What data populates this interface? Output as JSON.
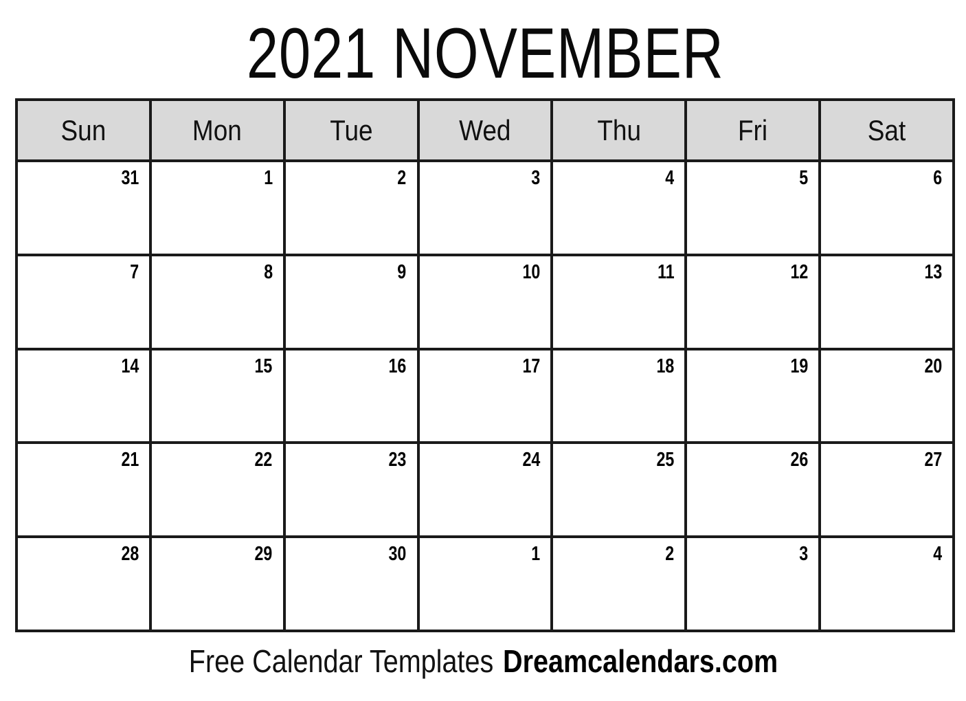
{
  "document": {
    "title": "2021 NOVEMBER",
    "year": "2021",
    "month": "NOVEMBER"
  },
  "colors": {
    "page_background": "#ffffff",
    "grid_line": "#1a1a1a",
    "weekday_header_background": "#d9d9d9",
    "text": "#000000"
  },
  "weekdays": [
    {
      "label": "Sun"
    },
    {
      "label": "Mon"
    },
    {
      "label": "Tue"
    },
    {
      "label": "Wed"
    },
    {
      "label": "Thu"
    },
    {
      "label": "Fri"
    },
    {
      "label": "Sat"
    }
  ],
  "weeks": [
    {
      "days": [
        {
          "number": "31",
          "in_month": false
        },
        {
          "number": "1",
          "in_month": true
        },
        {
          "number": "2",
          "in_month": true
        },
        {
          "number": "3",
          "in_month": true
        },
        {
          "number": "4",
          "in_month": true
        },
        {
          "number": "5",
          "in_month": true
        },
        {
          "number": "6",
          "in_month": true
        }
      ]
    },
    {
      "days": [
        {
          "number": "7",
          "in_month": true
        },
        {
          "number": "8",
          "in_month": true
        },
        {
          "number": "9",
          "in_month": true
        },
        {
          "number": "10",
          "in_month": true
        },
        {
          "number": "11",
          "in_month": true
        },
        {
          "number": "12",
          "in_month": true
        },
        {
          "number": "13",
          "in_month": true
        }
      ]
    },
    {
      "days": [
        {
          "number": "14",
          "in_month": true
        },
        {
          "number": "15",
          "in_month": true
        },
        {
          "number": "16",
          "in_month": true
        },
        {
          "number": "17",
          "in_month": true
        },
        {
          "number": "18",
          "in_month": true
        },
        {
          "number": "19",
          "in_month": true
        },
        {
          "number": "20",
          "in_month": true
        }
      ]
    },
    {
      "days": [
        {
          "number": "21",
          "in_month": true
        },
        {
          "number": "22",
          "in_month": true
        },
        {
          "number": "23",
          "in_month": true
        },
        {
          "number": "24",
          "in_month": true
        },
        {
          "number": "25",
          "in_month": true
        },
        {
          "number": "26",
          "in_month": true
        },
        {
          "number": "27",
          "in_month": true
        }
      ]
    },
    {
      "days": [
        {
          "number": "28",
          "in_month": true
        },
        {
          "number": "29",
          "in_month": true
        },
        {
          "number": "30",
          "in_month": true
        },
        {
          "number": "1",
          "in_month": false
        },
        {
          "number": "2",
          "in_month": false
        },
        {
          "number": "3",
          "in_month": false
        },
        {
          "number": "4",
          "in_month": false
        }
      ]
    }
  ],
  "footer": {
    "tagline": "Free Calendar Templates",
    "brand": "Dreamcalendars.com"
  }
}
